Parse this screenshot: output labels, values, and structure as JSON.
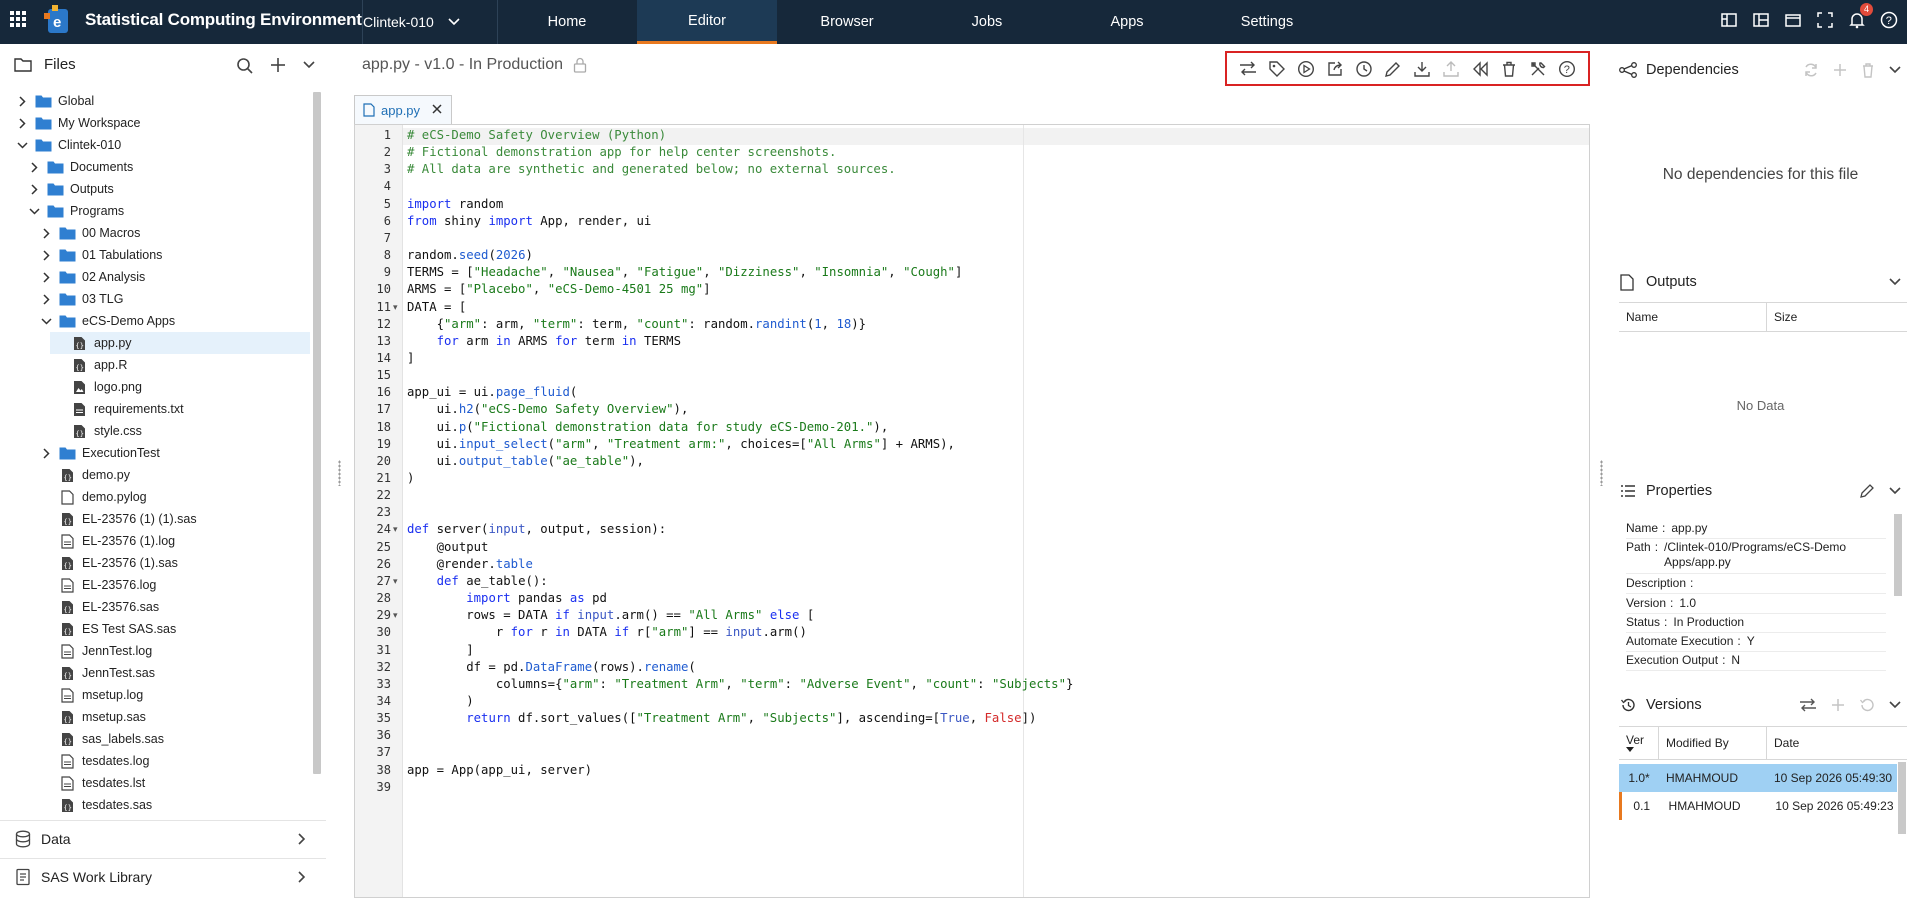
{
  "app": {
    "title": "Statistical Computing Environment",
    "project": "Clintek-010",
    "nav": [
      "Home",
      "Editor",
      "Browser",
      "Jobs",
      "Apps",
      "Settings"
    ],
    "active_nav": "Editor",
    "notifications": "4"
  },
  "files": {
    "title": "Files",
    "tree": [
      {
        "label": "Global",
        "type": "folder",
        "depth": 0,
        "expanded": false
      },
      {
        "label": "My Workspace",
        "type": "folder",
        "depth": 0,
        "expanded": false
      },
      {
        "label": "Clintek-010",
        "type": "folder",
        "depth": 0,
        "expanded": true
      },
      {
        "label": "Documents",
        "type": "folder",
        "depth": 1,
        "expanded": false
      },
      {
        "label": "Outputs",
        "type": "folder",
        "depth": 1,
        "expanded": false
      },
      {
        "label": "Programs",
        "type": "folder",
        "depth": 1,
        "expanded": true
      },
      {
        "label": "00 Macros",
        "type": "folder",
        "depth": 2,
        "expanded": false
      },
      {
        "label": "01 Tabulations",
        "type": "folder",
        "depth": 2,
        "expanded": false
      },
      {
        "label": "02 Analysis",
        "type": "folder",
        "depth": 2,
        "expanded": false
      },
      {
        "label": "03 TLG",
        "type": "folder",
        "depth": 2,
        "expanded": false
      },
      {
        "label": "eCS-Demo Apps",
        "type": "folder",
        "depth": 2,
        "expanded": true
      },
      {
        "label": "app.py",
        "type": "code",
        "depth": 3,
        "selected": true
      },
      {
        "label": "app.R",
        "type": "code",
        "depth": 3
      },
      {
        "label": "logo.png",
        "type": "image",
        "depth": 3
      },
      {
        "label": "requirements.txt",
        "type": "doc",
        "depth": 3
      },
      {
        "label": "style.css",
        "type": "code",
        "depth": 3
      },
      {
        "label": "ExecutionTest",
        "type": "folder",
        "depth": 2,
        "expanded": false
      },
      {
        "label": "demo.py",
        "type": "code",
        "depth": 2
      },
      {
        "label": "demo.pylog",
        "type": "file",
        "depth": 2
      },
      {
        "label": "EL-23576 (1) (1).sas",
        "type": "code",
        "depth": 2
      },
      {
        "label": "EL-23576 (1).log",
        "type": "log",
        "depth": 2
      },
      {
        "label": "EL-23576 (1).sas",
        "type": "code",
        "depth": 2
      },
      {
        "label": "EL-23576.log",
        "type": "log",
        "depth": 2
      },
      {
        "label": "EL-23576.sas",
        "type": "code",
        "depth": 2
      },
      {
        "label": "ES Test SAS.sas",
        "type": "code",
        "depth": 2
      },
      {
        "label": "JennTest.log",
        "type": "log",
        "depth": 2
      },
      {
        "label": "JennTest.sas",
        "type": "code",
        "depth": 2
      },
      {
        "label": "msetup.log",
        "type": "log",
        "depth": 2
      },
      {
        "label": "msetup.sas",
        "type": "code",
        "depth": 2
      },
      {
        "label": "sas_labels.sas",
        "type": "code",
        "depth": 2
      },
      {
        "label": "tesdates.log",
        "type": "log",
        "depth": 2
      },
      {
        "label": "tesdates.lst",
        "type": "log",
        "depth": 2
      },
      {
        "label": "tesdates.sas",
        "type": "code",
        "depth": 2
      }
    ],
    "data_label": "Data",
    "sas_work_label": "SAS Work Library"
  },
  "editor": {
    "heading": "app.py - v1.0 - In Production",
    "tab_label": "app.py",
    "toolbar_icons": [
      "compare-icon",
      "tag-icon",
      "run-icon",
      "share-icon",
      "history-icon",
      "edit-icon",
      "download-icon",
      "upload-icon",
      "rewind-icon",
      "delete-icon",
      "tools-icon",
      "help-icon"
    ],
    "lines": [
      "<span class=\"c\"># eCS-Demo Safety Overview (Python)</span>",
      "<span class=\"c\"># Fictional demonstration app for help center screenshots.</span>",
      "<span class=\"c\"># All data are synthetic and generated below; no external sources.</span>",
      "",
      "<span class=\"k\">import</span> random",
      "<span class=\"k\">from</span> shiny <span class=\"k\">import</span> App, render, ui",
      "",
      "random.<span class=\"n\">seed</span>(<span class=\"n\">2026</span>)",
      "TERMS = [<span class=\"s\">\"Headache\"</span>, <span class=\"s\">\"Nausea\"</span>, <span class=\"s\">\"Fatigue\"</span>, <span class=\"s\">\"Dizziness\"</span>, <span class=\"s\">\"Insomnia\"</span>, <span class=\"s\">\"Cough\"</span>]",
      "ARMS = [<span class=\"s\">\"Placebo\"</span>, <span class=\"s\">\"eCS-Demo-4501 25 mg\"</span>]",
      "DATA = [",
      "    {<span class=\"s\">\"arm\"</span>: arm, <span class=\"s\">\"term\"</span>: term, <span class=\"s\">\"count\"</span>: random.<span class=\"n\">randint</span>(<span class=\"n\">1</span>, <span class=\"n\">18</span>)}",
      "    <span class=\"k\">for</span> arm <span class=\"k\">in</span> ARMS <span class=\"k\">for</span> term <span class=\"k\">in</span> TERMS",
      "]",
      "",
      "app_ui = ui.<span class=\"n\">page_fluid</span>(",
      "    ui.<span class=\"n\">h2</span>(<span class=\"s\">\"eCS-Demo Safety Overview\"</span>),",
      "    ui.<span class=\"n\">p</span>(<span class=\"s\">\"Fictional demonstration data for study eCS-Demo-201.\"</span>),",
      "    ui.<span class=\"n\">input_select</span>(<span class=\"s\">\"arm\"</span>, <span class=\"s\">\"Treatment arm:\"</span>, choices=[<span class=\"s\">\"All Arms\"</span>] + ARMS),",
      "    ui.<span class=\"n\">output_table</span>(<span class=\"s\">\"ae_table\"</span>),",
      ")",
      "",
      "",
      "<span class=\"k\">def</span> server(<span class=\"b\">input</span>, output, session):",
      "    @output",
      "    @render.<span class=\"n\">table</span>",
      "    <span class=\"k\">def</span> ae_table():",
      "        <span class=\"k\">import</span> pandas <span class=\"k\">as</span> pd",
      "        rows = DATA <span class=\"k\">if</span> <span class=\"b\">input</span>.arm() == <span class=\"s\">\"All Arms\"</span> <span class=\"k\">else</span> [",
      "            r <span class=\"k\">for</span> r <span class=\"k\">in</span> DATA <span class=\"k\">if</span> r[<span class=\"s\">\"arm\"</span>] == <span class=\"b\">input</span>.arm()",
      "        ]",
      "        df = pd.<span class=\"n\">DataFrame</span>(rows).<span class=\"n\">rename</span>(",
      "            columns={<span class=\"s\">\"arm\"</span>: <span class=\"s\">\"Treatment Arm\"</span>, <span class=\"s\">\"term\"</span>: <span class=\"s\">\"Adverse Event\"</span>, <span class=\"s\">\"count\"</span>: <span class=\"s\">\"Subjects\"</span>}",
      "        )",
      "        <span class=\"k\">return</span> df.sort_values([<span class=\"s\">\"Treatment Arm\"</span>, <span class=\"s\">\"Subjects\"</span>], ascending=[<span class=\"b\">True</span>, <span class=\"a\">False</span>])",
      "",
      "",
      "app = App(app_ui, server)",
      ""
    ],
    "fold_lines": [
      11,
      24,
      27,
      29
    ]
  },
  "dependencies": {
    "title": "Dependencies",
    "empty_text": "No dependencies for this file"
  },
  "outputs": {
    "title": "Outputs",
    "columns": [
      "Name",
      "Size"
    ],
    "empty_text": "No Data"
  },
  "properties": {
    "title": "Properties",
    "rows": [
      {
        "key": "Name",
        "value": "app.py"
      },
      {
        "key": "Path",
        "value": "/Clintek-010/Programs/eCS-Demo Apps/app.py"
      },
      {
        "key": "Description",
        "value": ""
      },
      {
        "key": "Version",
        "value": "1.0"
      },
      {
        "key": "Status",
        "value": "In Production"
      },
      {
        "key": "Automate Execution",
        "value": "Y"
      },
      {
        "key": "Execution Output",
        "value": "N"
      }
    ]
  },
  "versions": {
    "title": "Versions",
    "columns": [
      "Ver",
      "Modified By",
      "Date"
    ],
    "rows": [
      {
        "ver": "1.0*",
        "by": "HMAHMOUD",
        "date": "10 Sep 2026 05:49:30",
        "selected": true
      },
      {
        "ver": "0.1",
        "by": "HMAHMOUD",
        "date": "10 Sep 2026 05:49:23",
        "selected": false
      }
    ]
  },
  "colors": {
    "topbar": "#16283a",
    "accent": "#e8791f",
    "folder": "#2f7fd1",
    "selection": "#e5f1fb",
    "toolbar_highlight": "#d92323"
  }
}
